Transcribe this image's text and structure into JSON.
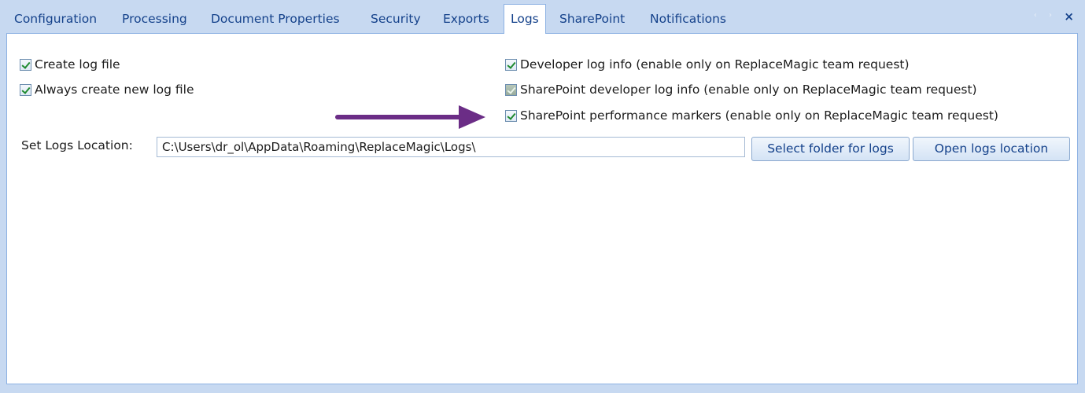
{
  "tabs": [
    {
      "label": "Configuration"
    },
    {
      "label": "Processing"
    },
    {
      "label": "Document Properties"
    },
    {
      "label": "Security"
    },
    {
      "label": "Exports"
    },
    {
      "label": "Logs"
    },
    {
      "label": "SharePoint"
    },
    {
      "label": "Notifications"
    }
  ],
  "active_tab": "Logs",
  "window_controls": {
    "scroll_arrows": "‹ ›",
    "close": "×"
  },
  "logs": {
    "create_log_file": {
      "label": "Create log file",
      "checked": true
    },
    "always_new_log_file": {
      "label": "Always create new log file",
      "checked": true
    },
    "developer_log_info": {
      "label": "Developer log info (enable only on ReplaceMagic team request)",
      "checked": true
    },
    "sharepoint_developer_log_info": {
      "label": "SharePoint developer log info (enable only on ReplaceMagic team request)",
      "checked": true
    },
    "sharepoint_performance_markers": {
      "label": "SharePoint performance markers (enable only on ReplaceMagic team request)",
      "checked": true
    },
    "location_label": "Set Logs Location:",
    "location_value": "C:\\Users\\dr_ol\\AppData\\Roaming\\ReplaceMagic\\Logs\\",
    "select_folder_button": "Select folder for logs",
    "open_location_button": "Open logs location"
  },
  "annotation": {
    "arrow_color": "#6b2d86"
  },
  "colors": {
    "accent": "#15428b",
    "background": "#c7d9f1",
    "border": "#8db2e3"
  }
}
